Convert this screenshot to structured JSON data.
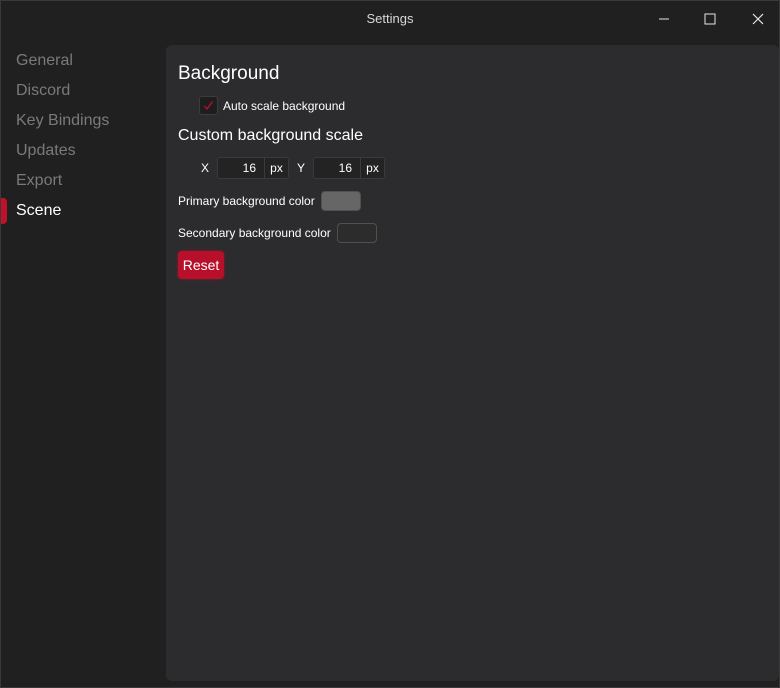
{
  "window": {
    "title": "Settings"
  },
  "sidebar": {
    "items": [
      {
        "label": "General",
        "active": false
      },
      {
        "label": "Discord",
        "active": false
      },
      {
        "label": "Key Bindings",
        "active": false
      },
      {
        "label": "Updates",
        "active": false
      },
      {
        "label": "Export",
        "active": false
      },
      {
        "label": "Scene",
        "active": true
      }
    ]
  },
  "main": {
    "section_title": "Background",
    "auto_scale": {
      "label": "Auto scale background",
      "checked": true
    },
    "custom_scale_title": "Custom background scale",
    "scale": {
      "x_label": "X",
      "x_value": "16",
      "y_label": "Y",
      "y_value": "16",
      "unit": "px"
    },
    "primary_color": {
      "label": "Primary background color",
      "value": "#666666"
    },
    "secondary_color": {
      "label": "Secondary background color",
      "value": "#2c2c2c"
    },
    "reset_label": "Reset"
  },
  "colors": {
    "accent": "#c0102a",
    "background": "#202020",
    "panel": "#2c2c2e"
  }
}
